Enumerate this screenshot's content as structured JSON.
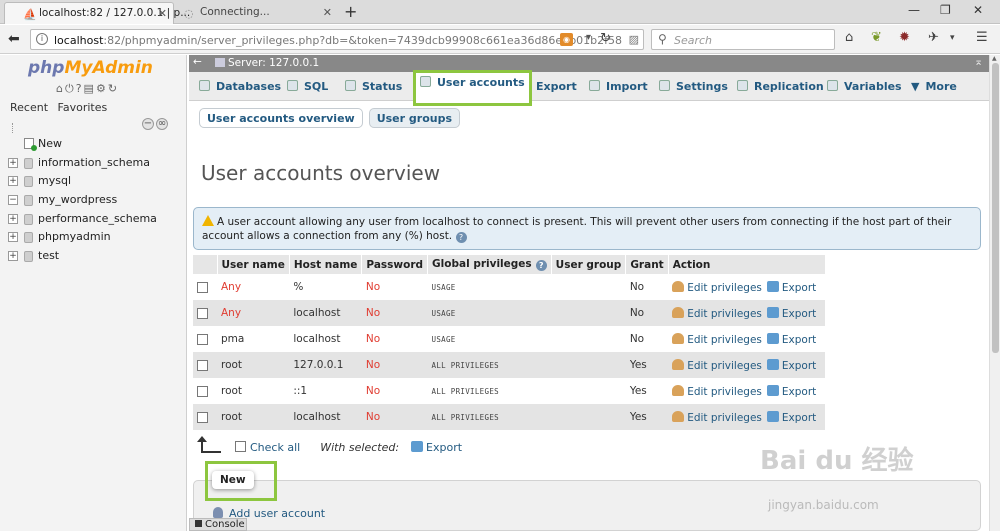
{
  "browser": {
    "tabs": [
      {
        "title": "localhost:82 / 127.0.0.1 | p...",
        "active": true
      },
      {
        "title": "Connecting...",
        "active": false
      }
    ],
    "url_host": "localhost",
    "url_rest": ":82/phpmyadmin/server_privileges.php?db=&token=7439dcb99908c661ea36d86e1b01b2f58",
    "search_placeholder": "Search"
  },
  "sidebar": {
    "logo_php": "php",
    "logo_my": "MyAdmin",
    "tabs": [
      "Recent",
      "Favorites"
    ],
    "databases": [
      "New",
      "information_schema",
      "mysql",
      "my_wordpress",
      "performance_schema",
      "phpmyadmin",
      "test"
    ]
  },
  "server_label": "Server: 127.0.0.1",
  "menu": [
    "Databases",
    "SQL",
    "Status",
    "User accounts",
    "Export",
    "Import",
    "Settings",
    "Replication",
    "Variables",
    "More"
  ],
  "subnav": [
    "User accounts overview",
    "User groups"
  ],
  "page_title": "User accounts overview",
  "notice": "A user account allowing any user from localhost to connect is present. This will prevent other users from connecting if the host part of their account allows a connection from any (%) host.",
  "table": {
    "headers": [
      "User name",
      "Host name",
      "Password",
      "Global privileges",
      "User group",
      "Grant",
      "Action"
    ],
    "rows": [
      {
        "user": "Any",
        "host": "%",
        "password": "No",
        "privs": "USAGE",
        "group": "",
        "grant": "No"
      },
      {
        "user": "Any",
        "host": "localhost",
        "password": "No",
        "privs": "USAGE",
        "group": "",
        "grant": "No"
      },
      {
        "user": "pma",
        "host": "localhost",
        "password": "No",
        "privs": "USAGE",
        "group": "",
        "grant": "No"
      },
      {
        "user": "root",
        "host": "127.0.0.1",
        "password": "No",
        "privs": "ALL PRIVILEGES",
        "group": "",
        "grant": "Yes"
      },
      {
        "user": "root",
        "host": "::1",
        "password": "No",
        "privs": "ALL PRIVILEGES",
        "group": "",
        "grant": "Yes"
      },
      {
        "user": "root",
        "host": "localhost",
        "password": "No",
        "privs": "ALL PRIVILEGES",
        "group": "",
        "grant": "Yes"
      }
    ],
    "edit_label": "Edit privileges",
    "export_label": "Export"
  },
  "footer": {
    "check_all": "Check all",
    "with_selected": "With selected:",
    "export": "Export"
  },
  "new_section": {
    "legend": "New",
    "add_user": "Add user account"
  },
  "console": "Console",
  "watermark": "Bai du 经验",
  "watermark_url": "jingyan.baidu.com"
}
